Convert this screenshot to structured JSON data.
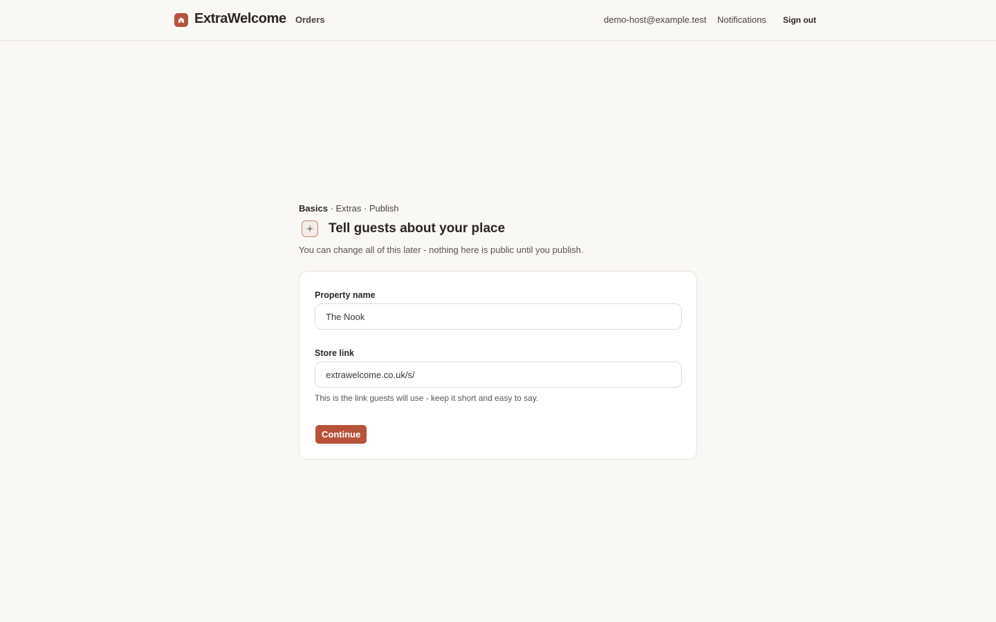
{
  "header": {
    "brand": "ExtraWelcome",
    "nav_orders": "Orders",
    "user_email": "demo-host@example.test",
    "nav_notifications": "Notifications",
    "sign_out": "Sign out"
  },
  "steps": {
    "current": "Basics",
    "separator1": " · ",
    "step2": "Extras",
    "separator2": " · ",
    "step3": "Publish"
  },
  "main": {
    "title": "Tell guests about your place",
    "subtitle": "You can change all of this later - nothing here is public until you publish."
  },
  "form": {
    "property_name_label": "Property name",
    "property_name_value": "The Nook",
    "store_link_label": "Store link",
    "store_link_value": "extrawelcome.co.uk/s/",
    "store_link_hint": "This is the link guests will use - keep it short and easy to say.",
    "continue_label": "Continue"
  },
  "colors": {
    "accent": "#b8513a",
    "background": "#f9f8f5"
  },
  "icons": {
    "brand": "house-icon",
    "title": "sparkle-icon"
  }
}
